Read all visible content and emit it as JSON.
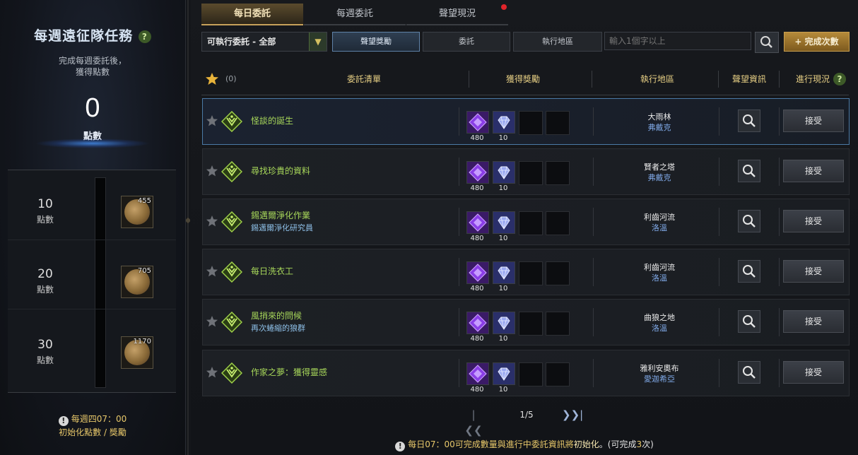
{
  "left_panel": {
    "title": "每週遠征隊任務",
    "help": "?",
    "description_line1": "完成每週委託後，",
    "description_line2": "獲得點數",
    "points": "0",
    "points_label": "點數",
    "tiers": [
      {
        "value": "10",
        "label": "點數",
        "reward_count": "455"
      },
      {
        "value": "20",
        "label": "點數",
        "reward_count": "705"
      },
      {
        "value": "30",
        "label": "點數",
        "reward_count": "1170"
      }
    ],
    "reset_line1": "每週四07：00",
    "reset_line2": "初始化點數 / 獎勵"
  },
  "tabs": [
    {
      "label": "每日委託",
      "active": true
    },
    {
      "label": "每週委託",
      "active": false
    },
    {
      "label": "聲望現況",
      "active": false,
      "notification": true
    }
  ],
  "filters": {
    "select_value": "可執行委託 - 全部",
    "buttons": [
      "聲望獎勵",
      "委託",
      "執行地區"
    ],
    "search_placeholder": "輸入1個字以上",
    "complete_button": "完成次數",
    "complete_icon": "+"
  },
  "table": {
    "favorite_count": "(0)",
    "headers": [
      "委託清單",
      "獲得獎勵",
      "執行地區",
      "聲望資訊",
      "進行現況"
    ],
    "help": "?",
    "accept_label": "接受",
    "rows": [
      {
        "name": "怪談的誕生",
        "subtitle": "",
        "reward1": "480",
        "reward2": "10",
        "location": "大雨林",
        "region": "弗戴克",
        "selected": true
      },
      {
        "name": "尋找珍貴的資料",
        "subtitle": "",
        "reward1": "480",
        "reward2": "10",
        "location": "賢者之塔",
        "region": "弗戴克",
        "selected": false
      },
      {
        "name": "錫邁爾淨化作業",
        "subtitle": "錫邁爾淨化研究員",
        "reward1": "480",
        "reward2": "10",
        "location": "利齒河流",
        "region": "洛溫",
        "selected": false
      },
      {
        "name": "每日洗衣工",
        "subtitle": "",
        "reward1": "480",
        "reward2": "10",
        "location": "利齒河流",
        "region": "洛溫",
        "selected": false
      },
      {
        "name": "風捎來的問候",
        "subtitle": "再次蜷縮的狼群",
        "reward1": "480",
        "reward2": "10",
        "location": "曲狼之地",
        "region": "洛溫",
        "selected": false
      },
      {
        "name": "作家之夢：獲得靈感",
        "subtitle": "",
        "reward1": "480",
        "reward2": "10",
        "location": "雅利安奧布",
        "region": "愛迦希亞",
        "selected": false
      }
    ]
  },
  "pagination": {
    "current": "1/5"
  },
  "footer": {
    "part1": "每日07：00可完成數量與進行中委託資訊將",
    "highlight": "初始化",
    "part2": "。(可完成",
    "count": "3",
    "part3": "次)"
  },
  "colors": {
    "accent_gold": "#c7a25a",
    "quest_name": "#a8d85a",
    "region_blue": "#7fa8e6",
    "notice_yellow": "#e8c86a"
  }
}
